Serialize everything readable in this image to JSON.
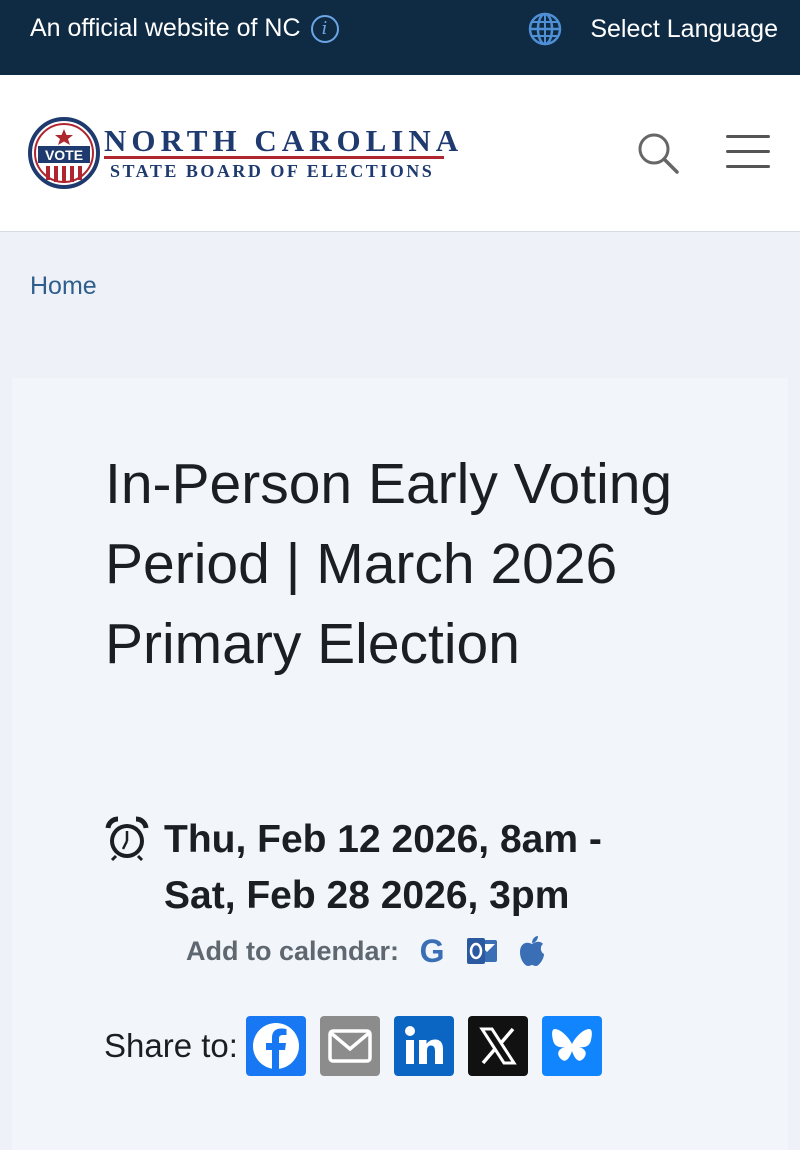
{
  "topbar": {
    "official_text": "An official website of NC",
    "language_label": "Select Language"
  },
  "header": {
    "logo_seal_text": "VOTE",
    "logo_line1": "NORTH CAROLINA",
    "logo_line2": "STATE BOARD OF ELECTIONS"
  },
  "breadcrumb": {
    "home": "Home"
  },
  "event": {
    "title": "In-Person Early Voting Period | March 2026 Primary Election",
    "time_line1": "Thu, Feb 12 2026, 8am -",
    "time_line2": "Sat, Feb 28 2026, 3pm",
    "add_to_calendar_label": "Add to calendar:",
    "calendar_options": [
      "google-icon",
      "outlook-icon",
      "apple-icon"
    ]
  },
  "share": {
    "label": "Share to:",
    "targets": [
      "facebook-icon",
      "email-icon",
      "linkedin-icon",
      "x-icon",
      "bluesky-icon"
    ]
  },
  "colors": {
    "topbar_bg": "#0f2a43",
    "brand_navy": "#1e3a6e",
    "brand_red": "#b0262f",
    "link": "#2f5e8c",
    "facebook": "#1877f2",
    "linkedin": "#0a66c2",
    "bluesky": "#1185fe"
  }
}
